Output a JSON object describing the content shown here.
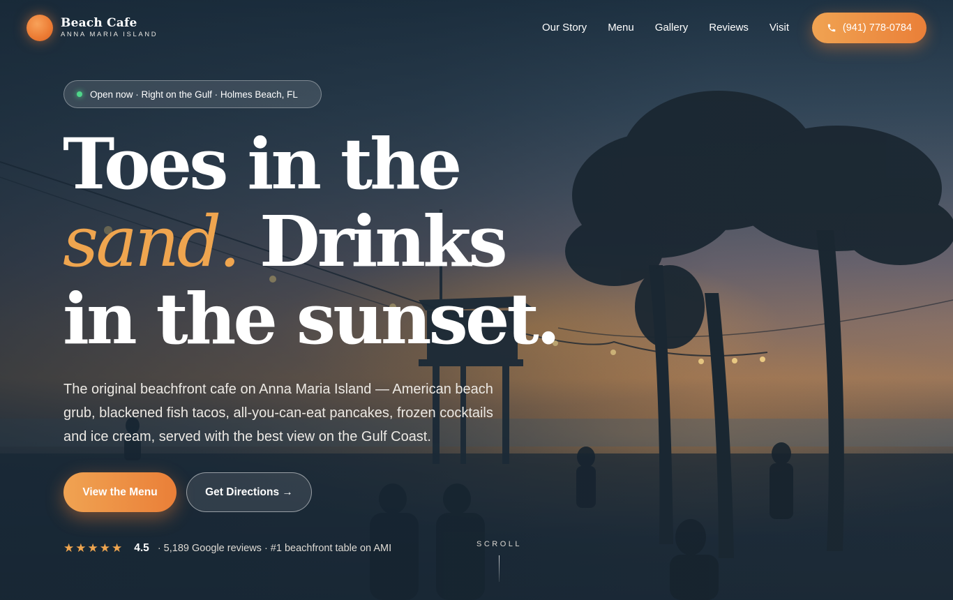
{
  "brand": {
    "name": "Beach Cafe",
    "location": "ANNA MARIA ISLAND"
  },
  "nav": {
    "items": [
      {
        "label": "Our Story"
      },
      {
        "label": "Menu"
      },
      {
        "label": "Gallery"
      },
      {
        "label": "Reviews"
      },
      {
        "label": "Visit"
      }
    ],
    "phone": "(941) 778-0784"
  },
  "hero": {
    "status": "Open now · Right on the Gulf · Holmes Beach, FL",
    "headline": {
      "line1": "Toes in the",
      "accent": "sand.",
      "line2_rest": " Drinks",
      "line3": "in the sunset."
    },
    "description": "The original beachfront cafe on Anna Maria Island — American beach grub, blackened fish tacos, all-you-can-eat pancakes, frozen cocktails and ice cream, served with the best view on the Gulf Coast.",
    "primary_cta": "View the Menu",
    "secondary_cta": "Get Directions →",
    "rating": {
      "stars": 5,
      "score": "4.5",
      "detail": "· 5,189 Google reviews · #1 beachfront table on AMI"
    },
    "scroll_label": "SCROLL"
  },
  "colors": {
    "accent": "#efa54f",
    "accent_dark": "#ea7f38",
    "status_green": "#4fd68a",
    "overlay": "#162634"
  },
  "icons": {
    "phone": "phone-icon",
    "star": "star-icon",
    "status": "status-dot"
  }
}
